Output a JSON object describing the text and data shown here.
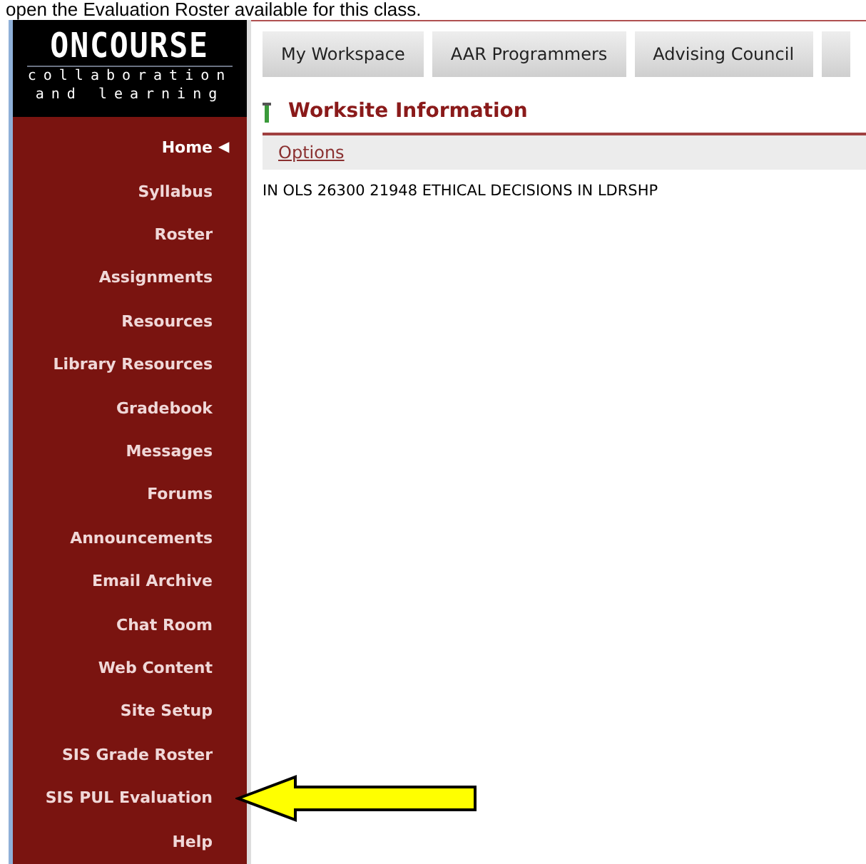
{
  "instruction": "open the Evaluation Roster available for this class.",
  "logo": {
    "title": "ONCOURSE",
    "line_1": "collaboration",
    "line_2": "and learning"
  },
  "tabs": [
    {
      "label": "My Workspace"
    },
    {
      "label": "AAR Programmers"
    },
    {
      "label": "Advising Council"
    }
  ],
  "sidebar": {
    "marker": "◀",
    "items": [
      {
        "label": "Home",
        "selected": true,
        "pointed": false
      },
      {
        "label": "Syllabus",
        "selected": false,
        "pointed": false
      },
      {
        "label": "Roster",
        "selected": false,
        "pointed": false
      },
      {
        "label": "Assignments",
        "selected": false,
        "pointed": false
      },
      {
        "label": "Resources",
        "selected": false,
        "pointed": false
      },
      {
        "label": "Library Resources",
        "selected": false,
        "pointed": false
      },
      {
        "label": "Gradebook",
        "selected": false,
        "pointed": false
      },
      {
        "label": "Messages",
        "selected": false,
        "pointed": false
      },
      {
        "label": "Forums",
        "selected": false,
        "pointed": false
      },
      {
        "label": "Announcements",
        "selected": false,
        "pointed": false
      },
      {
        "label": "Email Archive",
        "selected": false,
        "pointed": false
      },
      {
        "label": "Chat Room",
        "selected": false,
        "pointed": false
      },
      {
        "label": "Web Content",
        "selected": false,
        "pointed": false
      },
      {
        "label": "Site Setup",
        "selected": false,
        "pointed": false
      },
      {
        "label": "SIS Grade Roster",
        "selected": false,
        "pointed": false
      },
      {
        "label": "SIS PUL Evaluation",
        "selected": false,
        "pointed": true
      },
      {
        "label": "Help",
        "selected": false,
        "pointed": false
      }
    ]
  },
  "panel": {
    "title": "Worksite Information",
    "options_link": "Options",
    "body": "IN OLS 26300 21948 ETHICAL DECISIONS IN LDRSHP"
  },
  "callout": {
    "kind": "arrow"
  }
}
